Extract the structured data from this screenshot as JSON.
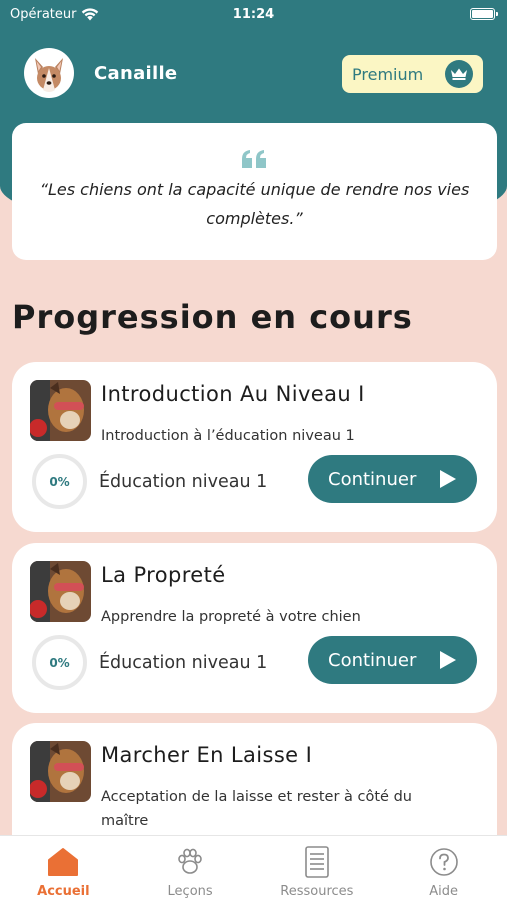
{
  "status_bar": {
    "carrier": "Opérateur",
    "time": "11:24"
  },
  "profile": {
    "username": "Canaille"
  },
  "premium": {
    "label": "Premium"
  },
  "quote": {
    "text": "“Les chiens ont la capacité unique de rendre nos vies complètes.”"
  },
  "section": {
    "title": "Progression en cours"
  },
  "lessons": [
    {
      "title": "Introduction Au Niveau I",
      "subtitle": "Introduction à l’éducation niveau 1",
      "progress": "0%",
      "level": "Éducation niveau 1",
      "button": "Continuer"
    },
    {
      "title": "La Propreté",
      "subtitle": "Apprendre la propreté à votre chien",
      "progress": "0%",
      "level": "Éducation niveau 1",
      "button": "Continuer"
    },
    {
      "title": "Marcher En Laisse I",
      "subtitle": "Acceptation de la laisse et rester à côté du maître"
    }
  ],
  "tabs": [
    {
      "label": "Accueil",
      "icon": "home-icon",
      "active": true
    },
    {
      "label": "Leçons",
      "icon": "paw-icon",
      "active": false
    },
    {
      "label": "Ressources",
      "icon": "document-icon",
      "active": false
    },
    {
      "label": "Aide",
      "icon": "help-icon",
      "active": false
    }
  ],
  "colors": {
    "primary": "#2f7a80",
    "background": "#f6d9d0",
    "accent": "#ea7035",
    "premium_bg": "#fbf6c4"
  }
}
